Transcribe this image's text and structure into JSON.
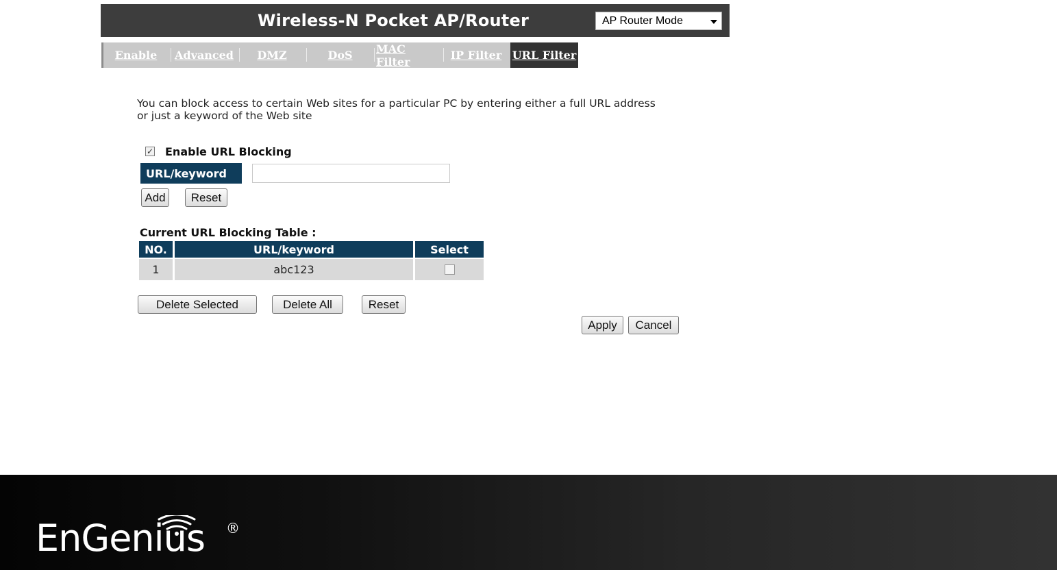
{
  "header": {
    "title": "Wireless-N Pocket AP/Router",
    "mode_select": {
      "value": "AP Router Mode"
    }
  },
  "tabs": [
    {
      "label": "Enable"
    },
    {
      "label": "Advanced"
    },
    {
      "label": "DMZ"
    },
    {
      "label": "DoS"
    },
    {
      "label": "MAC Filter"
    },
    {
      "label": "IP Filter"
    },
    {
      "label": "URL Filter",
      "active": true
    }
  ],
  "description": {
    "line1": "You can block access to certain Web sites for a particular PC by entering either a full URL address",
    "line2": "or just a keyword of the Web site"
  },
  "enable_url_blocking": {
    "label": "Enable URL Blocking",
    "checked": true
  },
  "keyword_form": {
    "label": "URL/keyword",
    "value": "",
    "add_label": "Add",
    "reset_label": "Reset"
  },
  "blocking_table": {
    "title": "Current URL Blocking Table :",
    "headers": [
      "NO.",
      "URL/keyword",
      "Select"
    ],
    "rows": [
      {
        "no": "1",
        "keyword": "abc123",
        "selected": false
      }
    ]
  },
  "table_actions": {
    "delete_selected_label": "Delete Selected",
    "delete_all_label": "Delete All",
    "reset_label": "Reset"
  },
  "form_actions": {
    "apply_label": "Apply",
    "cancel_label": "Cancel"
  },
  "footer": {
    "logo_text": "EnGenius",
    "registered_mark": "®"
  },
  "colors": {
    "header_bg": "#3d3d3d",
    "label_bg": "#0f3d5b",
    "tab_bg": "#c9c9c9",
    "active_tab_bg": "#333333"
  }
}
